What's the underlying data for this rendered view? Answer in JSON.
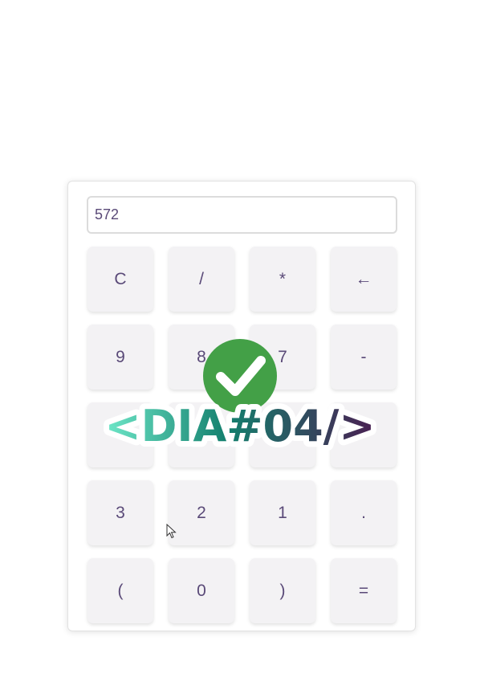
{
  "display": {
    "value": "572"
  },
  "keys": [
    {
      "label": "C",
      "name": "clear-button"
    },
    {
      "label": "/",
      "name": "divide-button"
    },
    {
      "label": "*",
      "name": "multiply-button"
    },
    {
      "label": "←",
      "name": "backspace-button"
    },
    {
      "label": "9",
      "name": "digit-9-button"
    },
    {
      "label": "8",
      "name": "digit-8-button"
    },
    {
      "label": "7",
      "name": "digit-7-button"
    },
    {
      "label": "-",
      "name": "subtract-button"
    },
    {
      "label": "",
      "name": "digit-6-button"
    },
    {
      "label": "",
      "name": "digit-5-button"
    },
    {
      "label": "",
      "name": "digit-4-button"
    },
    {
      "label": "",
      "name": "add-button"
    },
    {
      "label": "3",
      "name": "digit-3-button"
    },
    {
      "label": "2",
      "name": "digit-2-button"
    },
    {
      "label": "1",
      "name": "digit-1-button"
    },
    {
      "label": ".",
      "name": "decimal-button"
    },
    {
      "label": "(",
      "name": "open-paren-button"
    },
    {
      "label": "0",
      "name": "digit-0-button"
    },
    {
      "label": ")",
      "name": "close-paren-button"
    },
    {
      "label": "=",
      "name": "equals-button"
    }
  ],
  "watermark": {
    "text": "<DIA#04/>",
    "icon": "checkmark-icon",
    "check_color": "#43a047",
    "gradient_start": "#6ee7c8",
    "gradient_mid": "#14806e",
    "gradient_end": "#4a1f52"
  },
  "cursor": {
    "icon": "mouse-pointer-icon"
  }
}
